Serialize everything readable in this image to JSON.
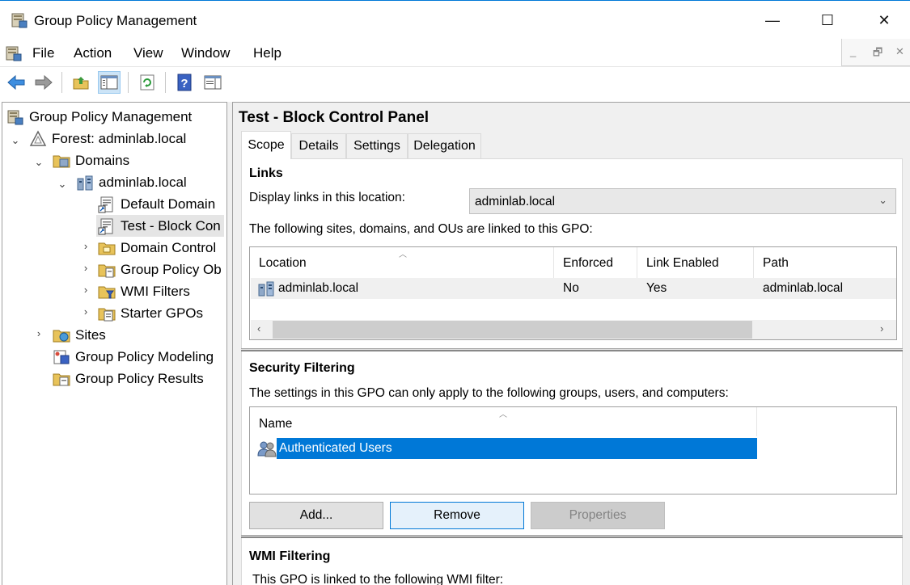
{
  "window": {
    "title": "Group Policy Management",
    "min_glyph": "—",
    "max_glyph": "☐",
    "close_glyph": "✕"
  },
  "menu": [
    "File",
    "Action",
    "View",
    "Window",
    "Help"
  ],
  "mdi_controls": {
    "min": "_",
    "restore": "🗗",
    "close": "✕"
  },
  "toolbar": {
    "icons": [
      "back-arrow-icon",
      "forward-arrow-icon",
      "up-folder-icon",
      "show-hide-console-tree-icon",
      "refresh-icon",
      "help-icon",
      "show-action-pane-icon"
    ]
  },
  "tree": {
    "items": [
      {
        "label": "Group Policy Management",
        "icon": "gpm-console-icon",
        "caret": ""
      },
      {
        "label": "Forest: adminlab.local",
        "icon": "forest-icon",
        "caret": "⌄"
      },
      {
        "label": "Domains",
        "icon": "domains-folder-icon",
        "caret": "⌄"
      },
      {
        "label": "adminlab.local",
        "icon": "domain-icon",
        "caret": "⌄"
      },
      {
        "label": "Default Domain",
        "icon": "gpo-link-icon",
        "caret": ""
      },
      {
        "label": "Test - Block Con",
        "icon": "gpo-link-icon",
        "caret": ""
      },
      {
        "label": "Domain Control",
        "icon": "ou-folder-icon",
        "caret": "›"
      },
      {
        "label": "Group Policy Ob",
        "icon": "gpo-folder-icon",
        "caret": "›"
      },
      {
        "label": "WMI Filters",
        "icon": "wmi-folder-icon",
        "caret": "›"
      },
      {
        "label": "Starter GPOs",
        "icon": "starter-gpo-folder-icon",
        "caret": "›"
      },
      {
        "label": "Sites",
        "icon": "sites-folder-icon",
        "caret": "›"
      },
      {
        "label": "Group Policy Modeling",
        "icon": "modeling-icon",
        "caret": ""
      },
      {
        "label": "Group Policy Results",
        "icon": "results-icon",
        "caret": ""
      }
    ]
  },
  "gpo": {
    "title": "Test - Block Control Panel",
    "tabs": [
      "Scope",
      "Details",
      "Settings",
      "Delegation"
    ],
    "links": {
      "heading": "Links",
      "display_label": "Display links in this location:",
      "display_value": "adminlab.local",
      "linked_label": "The following sites, domains, and OUs are linked to this GPO:",
      "columns": [
        "Location",
        "Enforced",
        "Link Enabled",
        "Path"
      ],
      "rows": [
        {
          "location": "adminlab.local",
          "enforced": "No",
          "link_enabled": "Yes",
          "path": "adminlab.local"
        }
      ]
    },
    "security": {
      "heading": "Security Filtering",
      "description": "The settings in this GPO can only apply to the following groups, users, and computers:",
      "column": "Name",
      "rows": [
        "Authenticated Users"
      ],
      "buttons": {
        "add": "Add...",
        "remove": "Remove",
        "properties": "Properties"
      }
    },
    "wmi": {
      "heading": "WMI Filtering",
      "description": "This GPO is linked to the following WMI filter:"
    }
  },
  "colors": {
    "selection": "#0078d7",
    "accent": "#0078d7",
    "pane_bg": "#f0f0f0"
  }
}
